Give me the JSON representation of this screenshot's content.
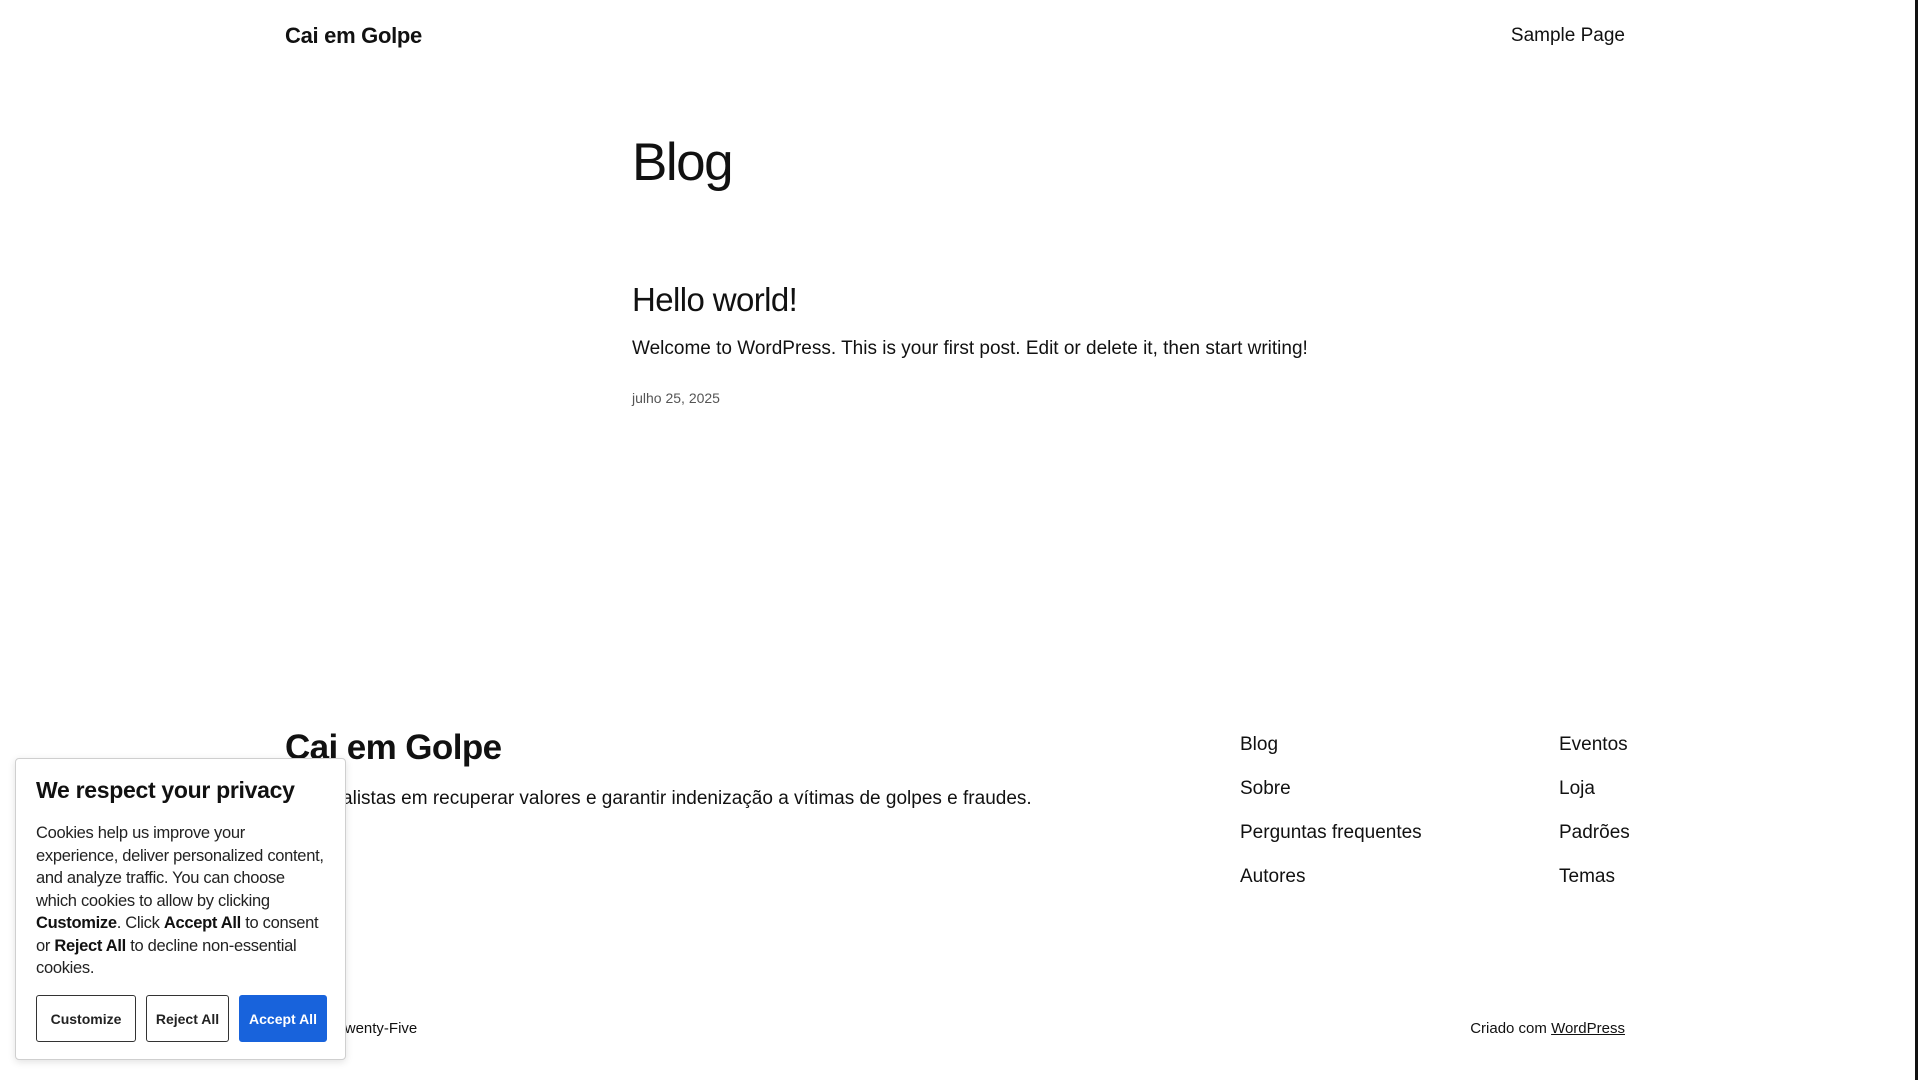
{
  "header": {
    "site_title": "Cai em Golpe",
    "nav": [
      "Sample Page"
    ]
  },
  "main": {
    "page_title": "Blog",
    "posts": [
      {
        "title": "Hello world!",
        "excerpt": "Welcome to WordPress. This is your first post. Edit or delete it, then start writing!",
        "date": "julho 25, 2025"
      }
    ]
  },
  "footer": {
    "site_title": "Cai em Golpe",
    "description": "Especialistas em recuperar valores e garantir indenização a vítimas de golpes e fraudes.",
    "nav_col1": [
      "Blog",
      "Sobre",
      "Perguntas frequentes",
      "Autores"
    ],
    "nav_col2": [
      "Eventos",
      "Loja",
      "Padrões",
      "Temas"
    ],
    "theme_credit": "Twenty Twenty-Five",
    "powered_prefix": "Criado com",
    "powered_link": "WordPress"
  },
  "cookie_banner": {
    "title": "We respect your privacy",
    "text_part1": "Cookies help us improve your experience, deliver personalized content, and analyze traffic. You can choose which cookies to allow by clicking ",
    "text_bold1": "Customize",
    "text_part2": ". Click ",
    "text_bold2": "Accept All",
    "text_part3": " to consent or ",
    "text_bold3": "Reject All",
    "text_part4": " to decline non-essential cookies.",
    "btn_customize": "Customize",
    "btn_reject": "Reject All",
    "btn_accept": "Accept All",
    "accept_color": "#1863dc"
  }
}
